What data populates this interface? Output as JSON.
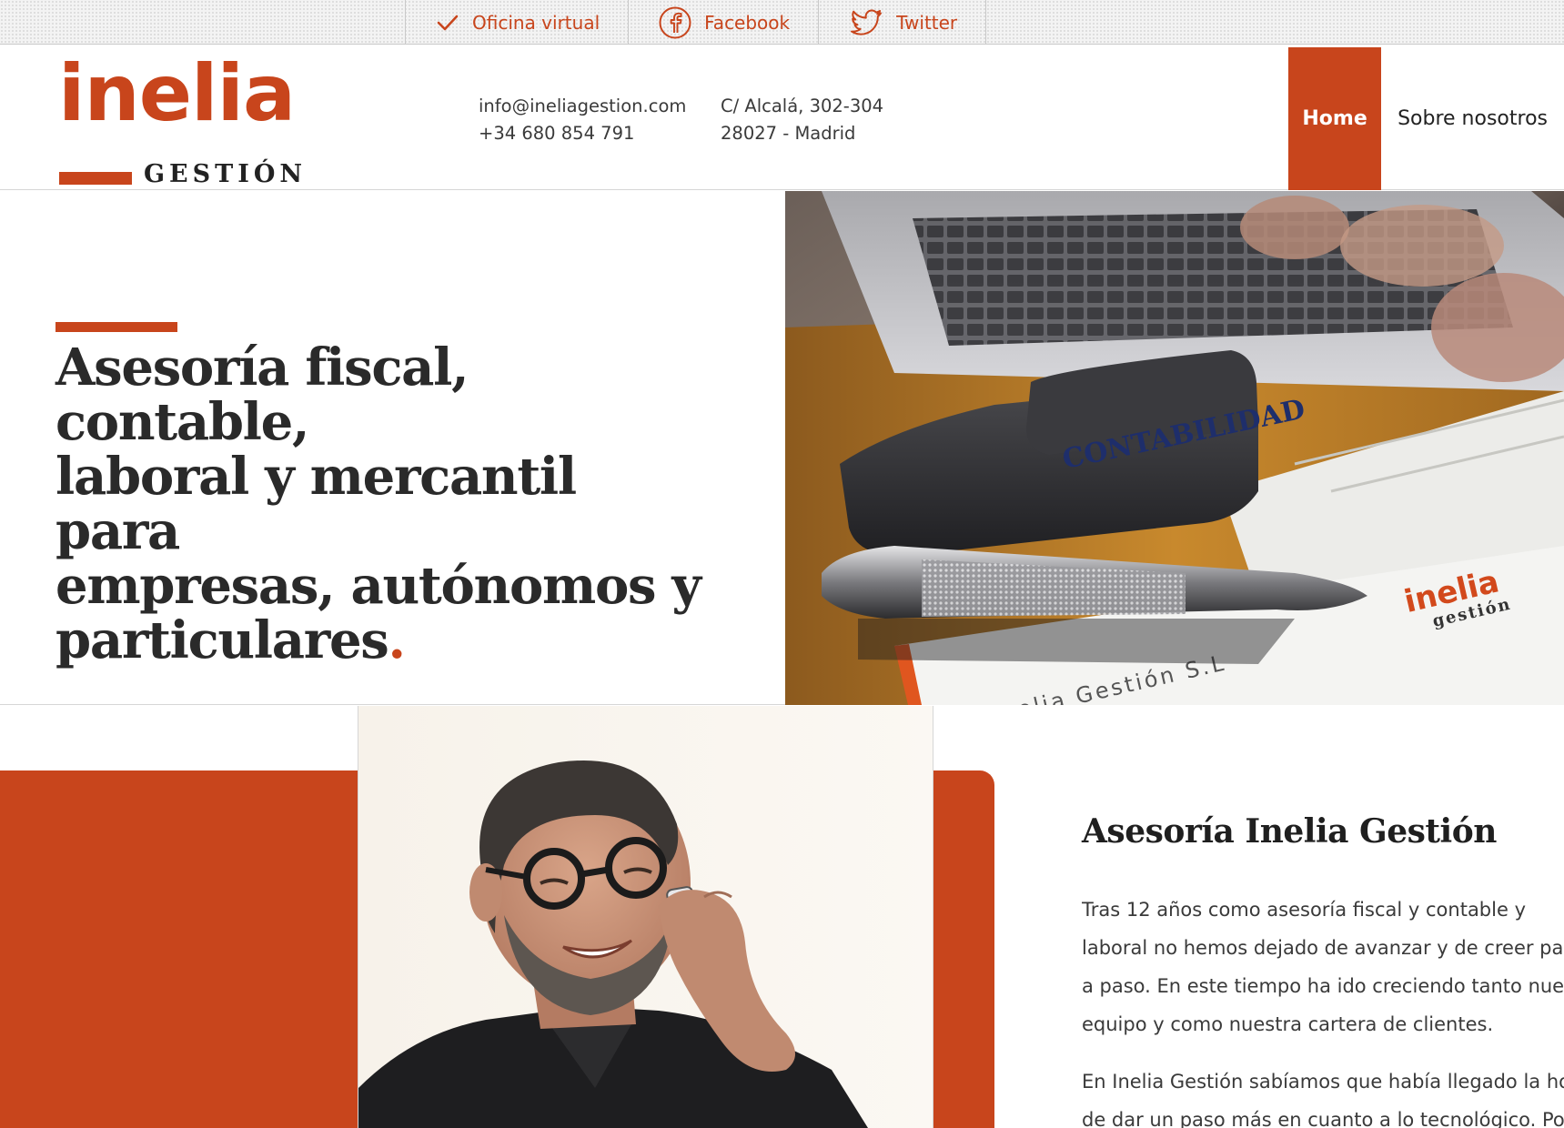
{
  "topbar": {
    "links": [
      {
        "label": "Oficina virtual",
        "icon": "check-icon"
      },
      {
        "label": "Facebook",
        "icon": "facebook-icon"
      },
      {
        "label": "Twitter",
        "icon": "twitter-icon"
      }
    ]
  },
  "header": {
    "logo": {
      "word": "inelia",
      "sub": "GESTIÓN"
    },
    "email": "info@ineliagestion.com",
    "phone": "+34 680 854 791",
    "address_line1": "C/ Alcalá, 302-304",
    "address_line2": "28027 - Madrid",
    "nav": [
      {
        "label": "Home",
        "active": true
      },
      {
        "label": "Sobre nosotros",
        "active": false
      }
    ]
  },
  "hero": {
    "title": "Asesoría fiscal, contable, laboral y mercantil para empresas, autónomos y particulares",
    "title_lines": [
      "Asesoría fiscal, contable,",
      "laboral y mercantil para",
      "empresas, autónomos y",
      "particulares"
    ],
    "title_dot": ".",
    "image_texts": {
      "stamp": "CONTABILIDAD",
      "card_name": "Inelia Gestión S.L",
      "card_logo": "inelia",
      "card_logo_sub": "gestión"
    }
  },
  "about": {
    "heading": "Asesoría Inelia Gestión",
    "paragraph1_lines": [
      "Tras 12 años como asesoría fiscal y contable y",
      "laboral no hemos dejado de avanzar y de creer paso",
      "a paso. En este tiempo ha ido creciendo tanto nuestro",
      "equipo y como nuestra cartera de clientes."
    ],
    "paragraph2_lines": [
      "En Inelia Gestión sabíamos que había llegado la hora",
      "de dar un paso más en cuanto a lo tecnológico. Por"
    ]
  },
  "colors": {
    "accent": "#c8451c",
    "text": "#2b2b2b",
    "topbar_bg": "#f3f3f3"
  }
}
